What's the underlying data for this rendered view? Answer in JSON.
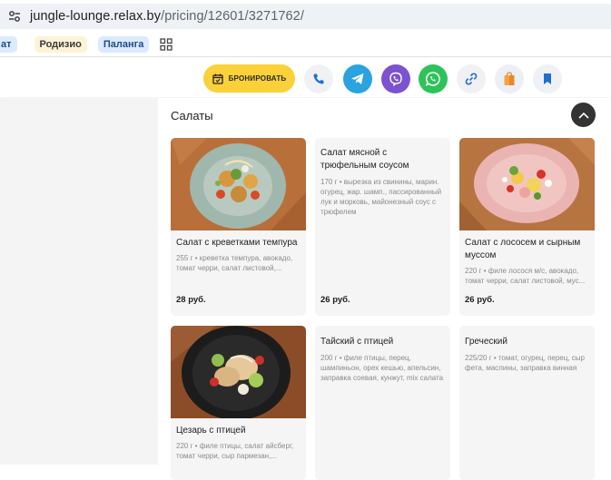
{
  "browser": {
    "url_host": "jungle-lounge.relax.by",
    "url_path": "/pricing/12601/3271762/"
  },
  "bookmarks": [
    {
      "label": "ат"
    },
    {
      "label": "Родизио"
    },
    {
      "label": "Паланга"
    }
  ],
  "header": {
    "book_label": "БРОНИРОВАТЬ",
    "actions": [
      {
        "icon": "phone-icon",
        "color": "#f0f1f4"
      },
      {
        "icon": "telegram-icon",
        "color": "#2aa3df"
      },
      {
        "icon": "viber-icon",
        "color": "#7b52cf"
      },
      {
        "icon": "whatsapp-icon",
        "color": "#2fc25b"
      },
      {
        "icon": "link-icon",
        "color": "#f0f1f4"
      },
      {
        "icon": "bag-icon",
        "color": "#eceff4"
      },
      {
        "icon": "bookmark-icon",
        "color": "#f0f1f4"
      }
    ]
  },
  "section": {
    "title": "Салаты"
  },
  "dishes": [
    {
      "name": "Салат с креветками темпура",
      "desc": "255 г • креветка темпура, авокадо, томат черри, салат листовой,...",
      "price": "28 руб.",
      "photo": "shrimp-salad"
    },
    {
      "name": "Салат мясной с трюфельным соусом",
      "desc": "170 г • вырезка из свинины, марин. огурец, жар. шамп., пассированный лук и морковь, майонезный соус с трюфелем",
      "price": "26 руб."
    },
    {
      "name": "Салат с лососем и сырным муссом",
      "desc": "220 г • филе лосося м/с, авокадо, томат черри, салат листовой, мус...",
      "price": "26 руб.",
      "photo": "salmon-salad"
    },
    {
      "name": "Цезарь с птицей",
      "desc": "220 г • филе птицы, салат айсберг, томат черри, сыр пармезан,...",
      "photo": "caesar-salad"
    },
    {
      "name": "Тайский с птицей",
      "desc": "200 г • филе птицы, перец, шампиньон, орех кешью, апельсин, заправка соевая, кунжут, mix салата"
    },
    {
      "name": "Греческий",
      "desc": "225/20 г • томат, огурец, перец, сыр фета, маслины, заправка винная"
    }
  ]
}
